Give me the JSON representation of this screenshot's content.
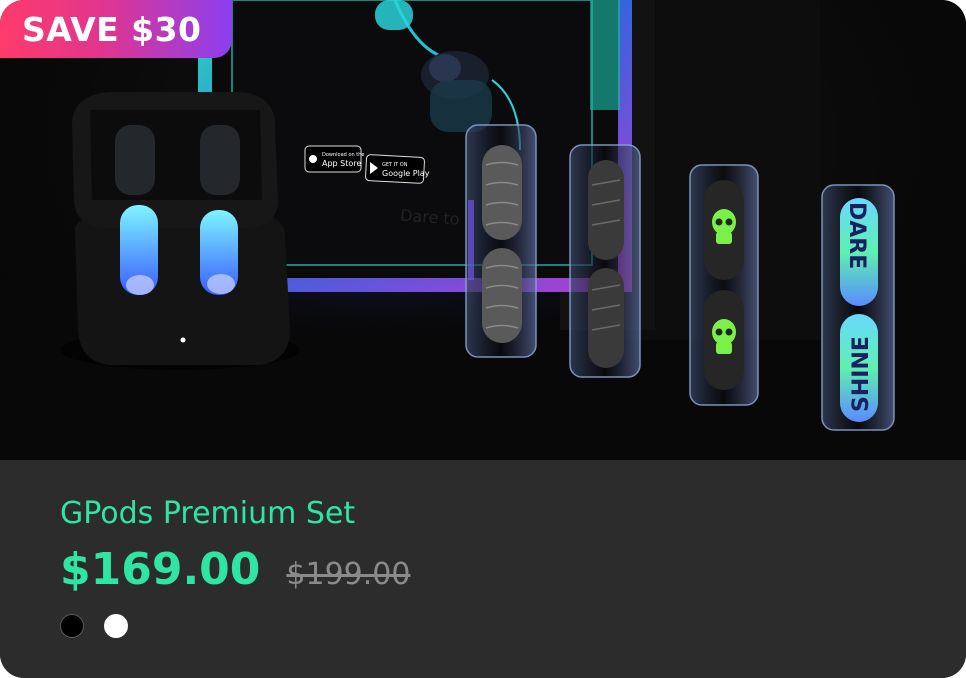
{
  "badge": {
    "label": "SAVE $30"
  },
  "product": {
    "name": "GPods Premium Set",
    "price": "$169.00",
    "original_price": "$199.00"
  },
  "color_options": [
    {
      "name": "Black",
      "hex": "#000000"
    },
    {
      "name": "White",
      "hex": "#ffffff"
    }
  ],
  "store_badges": {
    "app_store_small": "Download on the",
    "app_store": "App Store",
    "google_play_small": "GET IT ON",
    "google_play": "Google Play"
  },
  "packaging_text": "Dare to",
  "capsule_text": {
    "top": "DARE",
    "bottom": "SHINE"
  },
  "colors": {
    "accent": "#2ee5a4",
    "card_bg": "#2c2c2c",
    "badge_start": "#ff3b6b",
    "badge_end": "#8b3ff0",
    "strike": "#8a8a8a"
  }
}
